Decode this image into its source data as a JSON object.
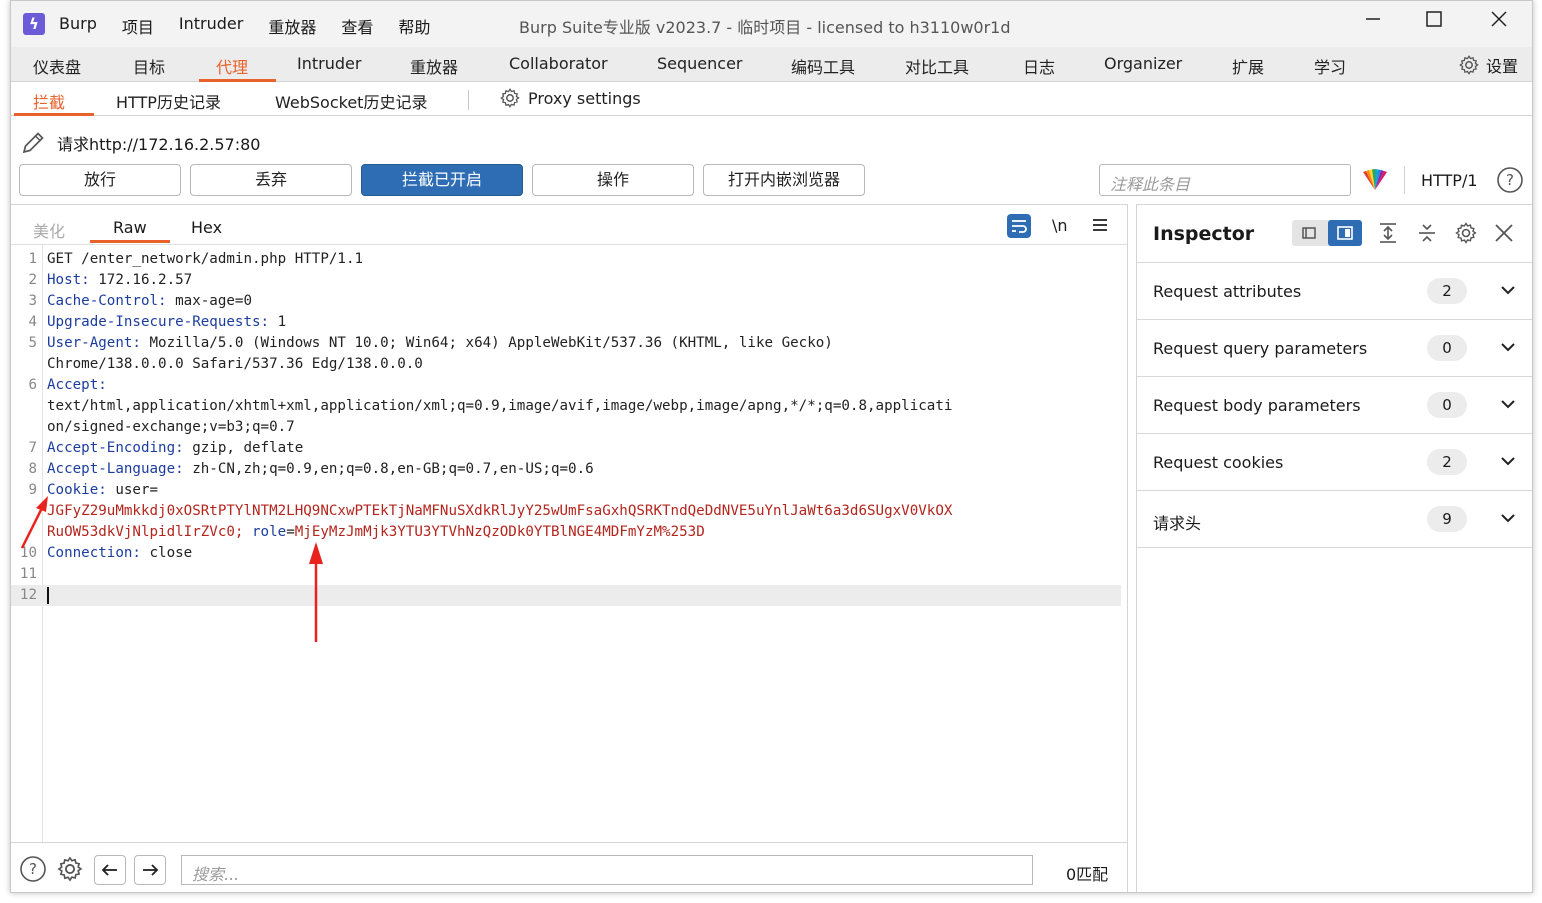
{
  "titlebar": {
    "menu": [
      "Burp",
      "项目",
      "Intruder",
      "重放器",
      "查看",
      "帮助"
    ],
    "title": "Burp Suite专业版  v2023.7 - 临时项目 - licensed to h3110w0r1d"
  },
  "main_tabs": [
    "仪表盘",
    "目标",
    "代理",
    "Intruder",
    "重放器",
    "Collaborator",
    "Sequencer",
    "编码工具",
    "对比工具",
    "日志",
    "Organizer",
    "扩展",
    "学习"
  ],
  "settings_label": "设置",
  "sub_tabs": [
    "拦截",
    "HTTP历史记录",
    "WebSocket历史记录"
  ],
  "proxy_settings": "Proxy settings",
  "request_line": "请求http://172.16.2.57:80",
  "buttons": {
    "forward": "放行",
    "drop": "丢弃",
    "intercept": "拦截已开启",
    "action": "操作",
    "browser": "打开内嵌浏览器"
  },
  "annotation_placeholder": "注释此条目",
  "http_version": "HTTP/1",
  "editor_tabs": [
    "美化",
    "Raw",
    "Hex"
  ],
  "newline_toggle": "\\n",
  "code_lines": [
    {
      "n": "1",
      "k": "",
      "v": "GET /enter_network/admin.php HTTP/1.1"
    },
    {
      "n": "2",
      "k": "Host:",
      "v": " 172.16.2.57"
    },
    {
      "n": "3",
      "k": "Cache-Control:",
      "v": " max-age=0"
    },
    {
      "n": "4",
      "k": "Upgrade-Insecure-Requests:",
      "v": " 1"
    },
    {
      "n": "5",
      "k": "User-Agent:",
      "v": " Mozilla/5.0 (Windows NT 10.0; Win64; x64) AppleWebKit/537.36 (KHTML, like Gecko)"
    },
    {
      "n": "",
      "k": "",
      "v": "Chrome/138.0.0.0 Safari/537.36 Edg/138.0.0.0"
    },
    {
      "n": "6",
      "k": "Accept:",
      "v": ""
    },
    {
      "n": "",
      "k": "",
      "v": "text/html,application/xhtml+xml,application/xml;q=0.9,image/avif,image/webp,image/apng,*/*;q=0.8,applicati"
    },
    {
      "n": "",
      "k": "",
      "v": "on/signed-exchange;v=b3;q=0.7"
    },
    {
      "n": "7",
      "k": "Accept-Encoding:",
      "v": " gzip, deflate"
    },
    {
      "n": "8",
      "k": "Accept-Language:",
      "v": " zh-CN,zh;q=0.9,en;q=0.8,en-GB;q=0.7,en-US;q=0.6"
    },
    {
      "n": "9",
      "k": "Cookie:",
      "v": " user="
    }
  ],
  "cookie_user_line1": "JGFyZ29uMmkkdj0xOSRtPTYlNTM2LHQ9NCxwPTEkTjNaMFNuSXdkRlJyY25wUmFsaGxhQSRKTndQeDdNVE5uYnlJaWt6a3d6SUgxV0VkOX",
  "cookie_user_line2": "RuOW53dkVjNlpidlIrZVc0;",
  "cookie_role_key": "role",
  "cookie_role_value": "MjEyMzJmMjk3YTU3YTVhNzQzODk0YTBlNGE4MDFmYzM%253D",
  "code_tail": [
    {
      "n": "10",
      "k": "Connection:",
      "v": " close"
    },
    {
      "n": "11",
      "k": "",
      "v": ""
    },
    {
      "n": "12",
      "k": "",
      "v": ""
    }
  ],
  "search_placeholder": "搜索...",
  "match_count": "0匹配",
  "inspector": {
    "title": "Inspector",
    "rows": [
      {
        "label": "Request attributes",
        "count": "2"
      },
      {
        "label": "Request query parameters",
        "count": "0"
      },
      {
        "label": "Request body parameters",
        "count": "0"
      },
      {
        "label": "Request cookies",
        "count": "2"
      },
      {
        "label": "请求头",
        "count": "9"
      }
    ]
  },
  "colors": {
    "accent": "#e8622b",
    "primary_button": "#2e6db4",
    "header_key": "#1c3d9e",
    "cookie_value": "#b3261e",
    "annotation_arrow": "#e8231e"
  }
}
